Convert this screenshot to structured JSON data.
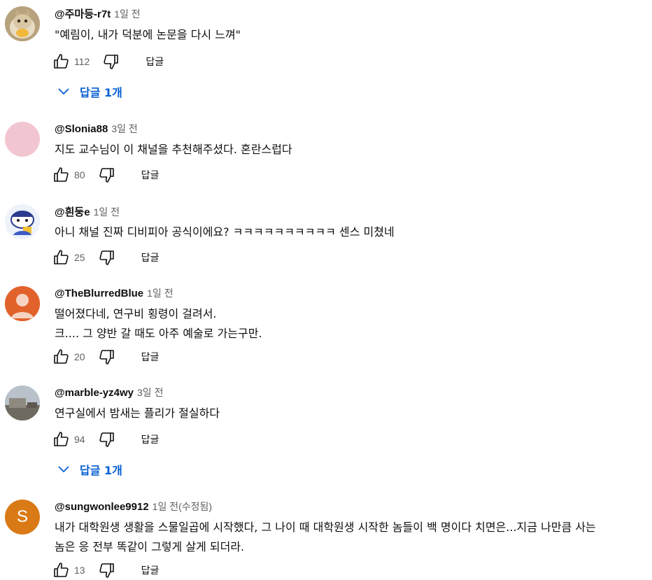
{
  "comments": [
    {
      "author": "@주마등-r7t",
      "time": "1일 전",
      "text": "\"예림이, 내가 덕분에 논문을 다시 느껴\"",
      "likes": "112",
      "reply_label": "답글",
      "replies_label": "답글 1개",
      "avatar": {
        "type": "photo",
        "color": "#c9b08a",
        "icon": "cat-photo"
      }
    },
    {
      "author": "@Slonia88",
      "time": "3일 전",
      "text": "지도 교수님이 이 채널을 추천해주셨다. 혼란스럽다",
      "likes": "80",
      "reply_label": "답글",
      "avatar": {
        "type": "solid",
        "color": "#f2c6d1"
      }
    },
    {
      "author": "@흰둥e",
      "time": "1일 전",
      "text": "아니 채널 진짜 디비피아 공식이에요? ㅋㅋㅋㅋㅋㅋㅋㅋㅋㅋ 센스 미쳤네",
      "likes": "25",
      "reply_label": "답글",
      "avatar": {
        "type": "illustration",
        "color": "#e6ecf7",
        "icon": "cartoon-character"
      }
    },
    {
      "author": "@TheBlurredBlue",
      "time": "1일 전",
      "text": "떨어졌다네, 연구비 횡령이 걸려서.\n크.... 그 양반 갈 때도 아주 예술로 가는구만.",
      "likes": "20",
      "reply_label": "답글",
      "avatar": {
        "type": "person",
        "color": "#e2622b",
        "icon": "person-silhouette"
      }
    },
    {
      "author": "@marble-yz4wy",
      "time": "3일 전",
      "text": "연구실에서 밤새는 플리가 절실하다",
      "likes": "94",
      "reply_label": "답글",
      "replies_label": "답글 1개",
      "avatar": {
        "type": "photo",
        "color": "#9aa3ab",
        "icon": "landscape-photo"
      }
    },
    {
      "author": "@sungwonlee9912",
      "time": "1일 전(수정됨)",
      "text": "내가 대학원생 생활을 스물일곱에 시작했다, 그 나이 때 대학원생 시작한 놈들이 백 명이다 치면은...지금 나만큼 사는\n놈은 응 전부 똑같이 그렇게 살게 되더라.",
      "likes": "13",
      "reply_label": "답글",
      "avatar": {
        "type": "letter",
        "color": "#d97a16",
        "letter": "S"
      }
    }
  ],
  "colors": {
    "link": "#065fd4",
    "muted": "#606060",
    "text": "#0f0f0f"
  }
}
